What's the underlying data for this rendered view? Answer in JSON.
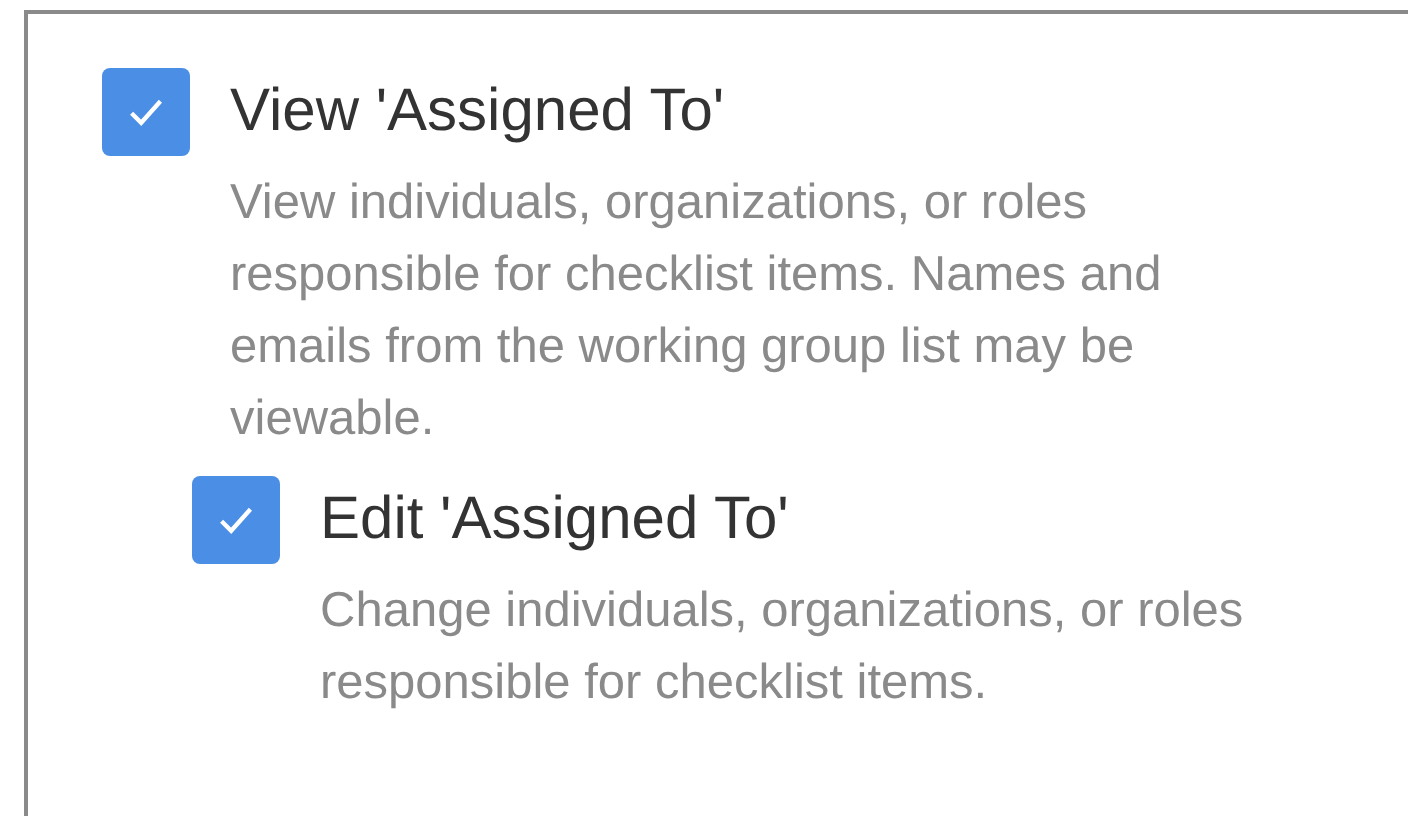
{
  "permissions": [
    {
      "label": "View 'Assigned To'",
      "description": "View individuals, organizations, or roles responsible for checklist items. Names and emails from the working group list may be viewable.",
      "checked": true,
      "children": [
        {
          "label": "Edit 'Assigned To'",
          "description": "Change individuals, organizations, or roles responsible for checklist items.",
          "checked": true
        }
      ]
    }
  ]
}
